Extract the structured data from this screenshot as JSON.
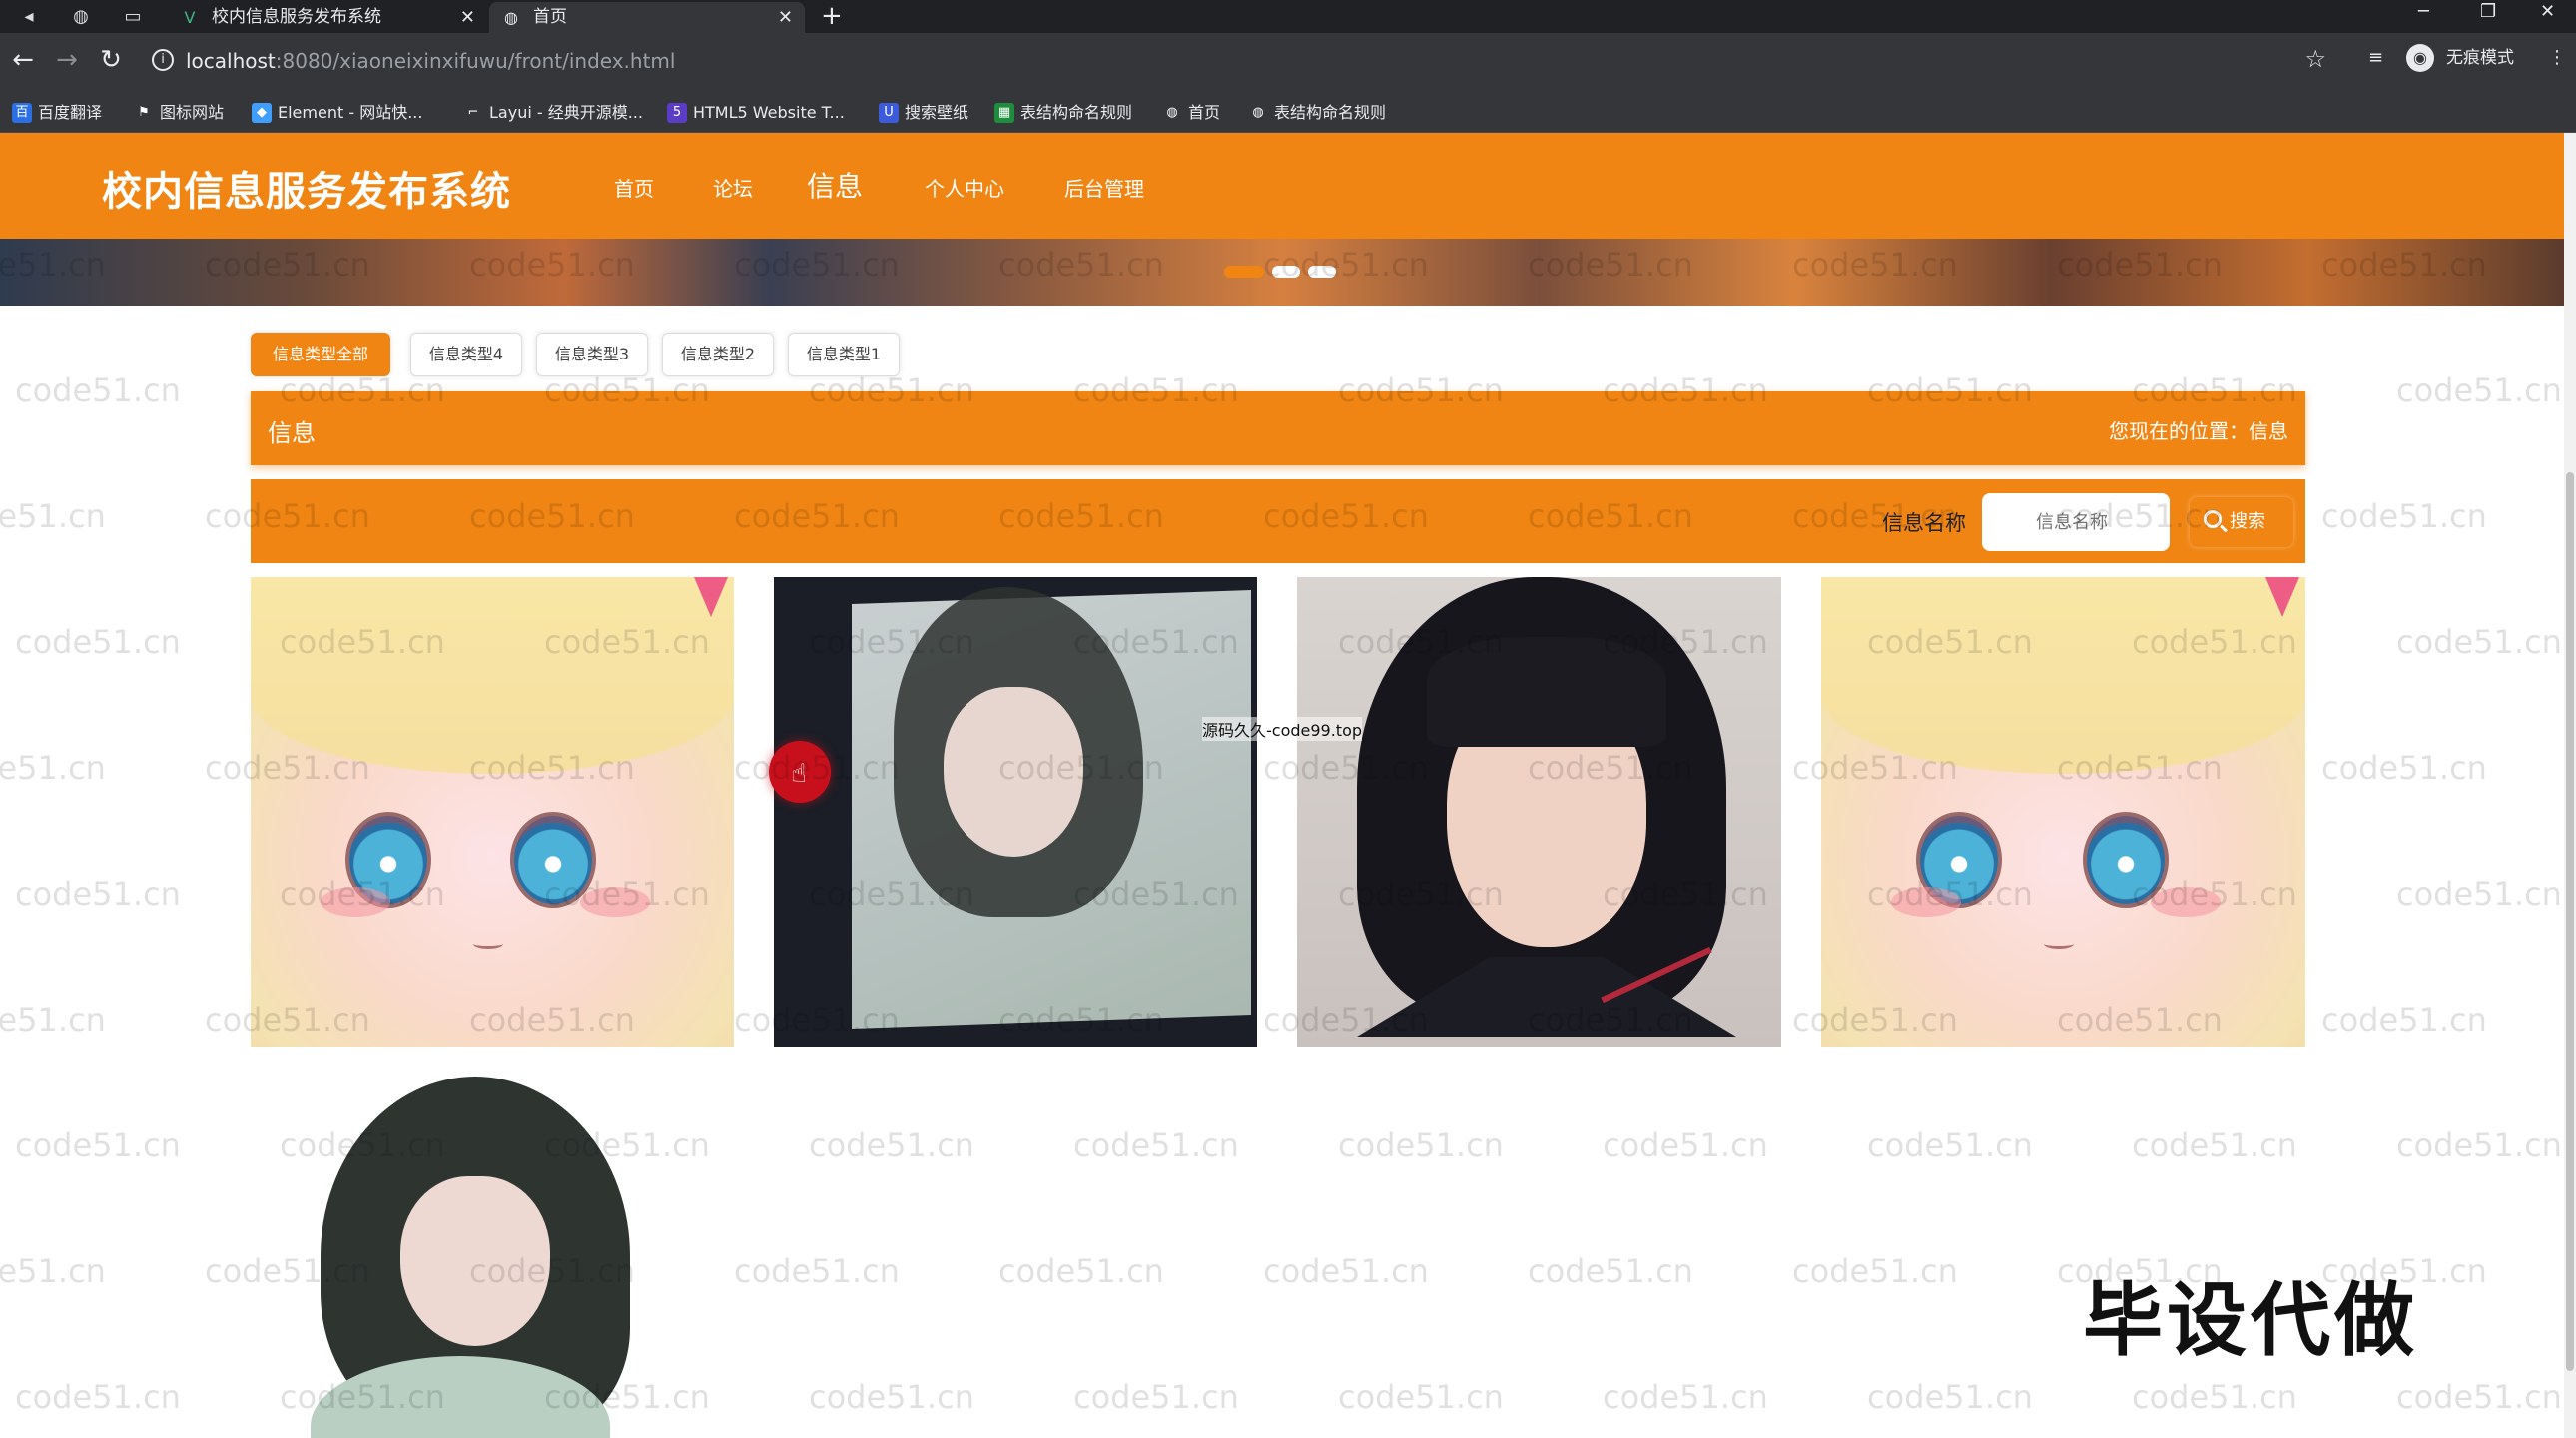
{
  "browser": {
    "tabs": [
      {
        "title": "校内信息服务发布系统",
        "favicon": "vue-icon"
      },
      {
        "title": "首页",
        "favicon": "globe-icon"
      }
    ],
    "new_tab": "+",
    "url_host": "localhost",
    "url_path": ":8080/xiaoneixinxifuwu/front/index.html",
    "incognito_label": "无痕模式",
    "bookmarks": [
      {
        "label": "百度翻译",
        "icon": "baidu-icon",
        "color": "#2b6fe4"
      },
      {
        "label": "图标网站",
        "icon": "flag-icon",
        "color": "#35363a"
      },
      {
        "label": "Element - 网站快...",
        "icon": "element-icon",
        "color": "#409eff"
      },
      {
        "label": "Layui - 经典开源模...",
        "icon": "layui-icon",
        "color": "#35363a"
      },
      {
        "label": "HTML5 Website T...",
        "icon": "html5-icon",
        "color": "#5b3cc4"
      },
      {
        "label": "搜索壁纸",
        "icon": "wallpaper-icon",
        "color": "#3b5bdb"
      },
      {
        "label": "表结构命名规则",
        "icon": "sheet-icon",
        "color": "#1e8e3e"
      },
      {
        "label": "首页",
        "icon": "globe-icon",
        "color": "#35363a"
      },
      {
        "label": "表结构命名规则",
        "icon": "globe-icon",
        "color": "#35363a"
      }
    ]
  },
  "header": {
    "title": "校内信息服务发布系统",
    "nav": [
      "首页",
      "论坛",
      "信息",
      "个人中心",
      "后台管理"
    ],
    "active_nav": "信息",
    "accent": "#f08513"
  },
  "filters": [
    "信息类型全部",
    "信息类型4",
    "信息类型3",
    "信息类型2",
    "信息类型1"
  ],
  "info_bar": {
    "label": "信息",
    "location": "您现在的位置：信息"
  },
  "search": {
    "label": "信息名称",
    "placeholder": "信息名称",
    "button": "搜索"
  },
  "overlay": {
    "center_text": "源码久久-code99.top",
    "watermark": "code51.cn",
    "big_text": "毕设代做"
  }
}
